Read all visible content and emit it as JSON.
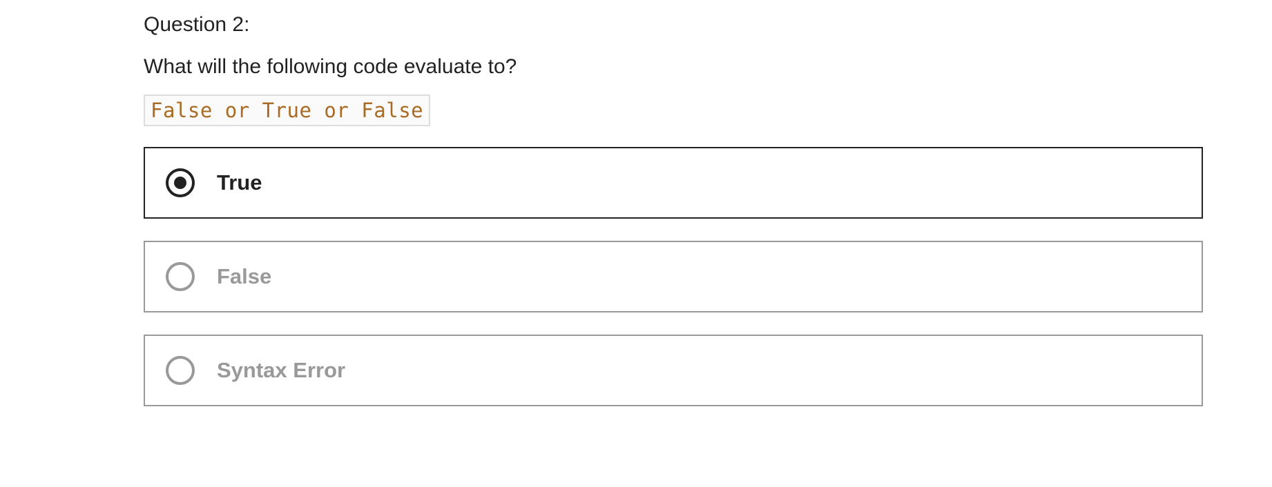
{
  "question": {
    "number_label": "Question 2:",
    "prompt": "What will the following code evaluate to?",
    "code": "False or True or False"
  },
  "options": [
    {
      "label": "True",
      "selected": true
    },
    {
      "label": "False",
      "selected": false
    },
    {
      "label": "Syntax Error",
      "selected": false
    }
  ],
  "colors": {
    "text": "#222222",
    "muted": "#999999",
    "code_text": "#a96b23",
    "code_border": "#dddddd"
  },
  "icons": {
    "selected": "radio-checked-icon",
    "unselected": "radio-unchecked-icon"
  }
}
